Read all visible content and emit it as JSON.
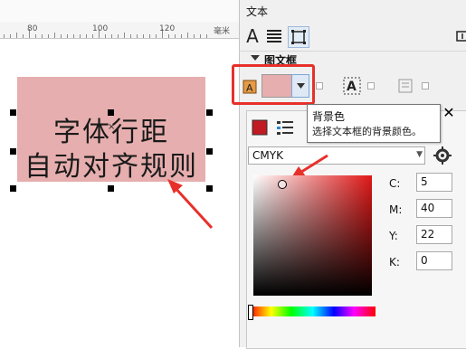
{
  "ruler": {
    "ticks": [
      "80",
      "100",
      "120"
    ],
    "units_glyph": "毫米"
  },
  "canvas": {
    "text_lines": [
      "字体行距",
      "自动对齐规则"
    ],
    "center_mark": "×"
  },
  "panel": {
    "title": "文本",
    "section_title": "图文框",
    "tooltip": {
      "title": "背景色",
      "description": "选择文本框的背景颜色。"
    },
    "close_label": "✕",
    "color_model": "CMYK",
    "cmyk": [
      {
        "label": "C:",
        "value": "5"
      },
      {
        "label": "M:",
        "value": "40"
      },
      {
        "label": "Y:",
        "value": "22"
      },
      {
        "label": "K:",
        "value": "0"
      }
    ],
    "background_color": "#e6aeae"
  },
  "colors": {
    "annotation_red": "#e8302a",
    "frame_fill": "#e6aeae"
  },
  "icons": [
    "text-A-icon",
    "paragraph-icon",
    "frame-icon",
    "dock-icon",
    "frame-fill-icon",
    "frame-text-icon",
    "frame-columns-icon",
    "fill-swatch-icon",
    "palette-settings-icon",
    "gear-icon"
  ]
}
